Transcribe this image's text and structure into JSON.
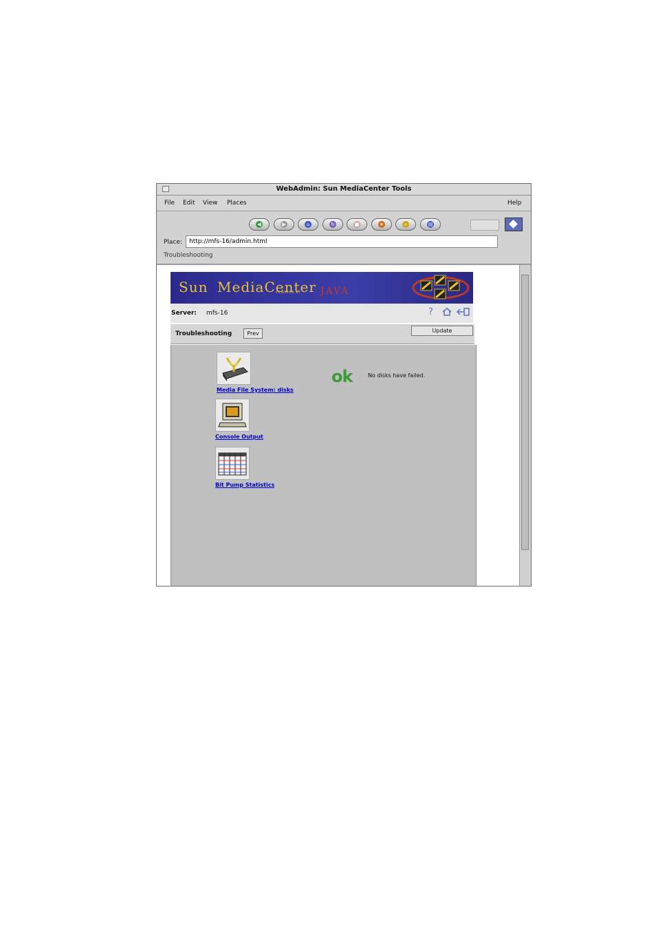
{
  "window": {
    "title": "WebAdmin: Sun MediaCenter Tools"
  },
  "menubar": {
    "items": [
      "File",
      "Edit",
      "View",
      "Places"
    ],
    "help": "Help"
  },
  "toolbar": {
    "nav_icons": [
      "back-icon",
      "forward-icon",
      "home-icon",
      "reload-icon",
      "stop-icon",
      "bookmarks-icon",
      "search-icon",
      "print-icon"
    ]
  },
  "location": {
    "label": "Place:",
    "url": "http://mfs-16/admin.html"
  },
  "status": {
    "page_title": "Troubleshooting"
  },
  "banner": {
    "sun": "Sun",
    "mediacenter": "MediaCenter",
    "powered_by": "POWERED BY",
    "java": "JAVA"
  },
  "server": {
    "label": "Server:",
    "value": "mfs-16"
  },
  "section": {
    "title": "Troubleshooting",
    "prev_label": "Prev",
    "update_label": "Update"
  },
  "tools": [
    {
      "label": "Media File System: disks",
      "icon": "disk-icon"
    },
    {
      "label": "Console Output",
      "icon": "console-icon"
    },
    {
      "label": "Bit Pump Statistics",
      "icon": "table-icon"
    }
  ],
  "disk_status": {
    "ok": "ok",
    "message": "No disks have failed."
  },
  "colors": {
    "banner": "#2c2a8c",
    "link": "#0000cc",
    "ok": "#3f9b3a"
  }
}
